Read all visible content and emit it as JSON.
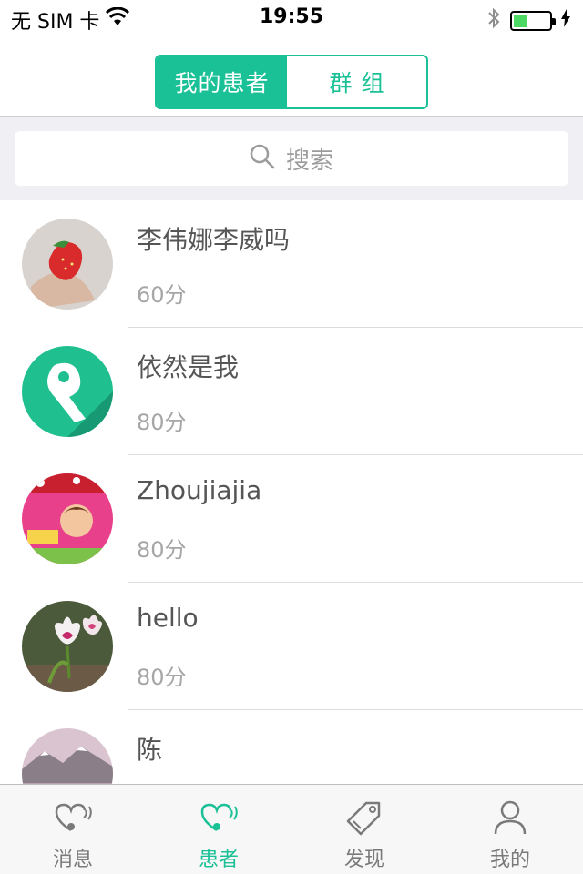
{
  "status_bar": {
    "carrier": "无 SIM 卡",
    "time": "19:55",
    "battery_level": 0.4
  },
  "nav": {
    "segments": [
      {
        "label": "我的患者",
        "active": true
      },
      {
        "label": "群组",
        "active": false
      }
    ],
    "accent_color": "#1ac096"
  },
  "search": {
    "placeholder": "搜索"
  },
  "patients": [
    {
      "name": "李伟娜李威吗",
      "score": "60分",
      "avatar": "strawberry-photo"
    },
    {
      "name": "依然是我",
      "score": "80分",
      "avatar": "green-logo"
    },
    {
      "name": "Zhoujiajia",
      "score": "80分",
      "avatar": "cartoon-photo"
    },
    {
      "name": "hello",
      "score": "80分",
      "avatar": "tulip-photo"
    },
    {
      "name": "陈",
      "score": "",
      "avatar": "mountain-photo"
    }
  ],
  "tabs": [
    {
      "label": "消息",
      "icon": "chat-heart-icon",
      "active": false
    },
    {
      "label": "患者",
      "icon": "patient-heart-icon",
      "active": true
    },
    {
      "label": "发现",
      "icon": "tag-icon",
      "active": false
    },
    {
      "label": "我的",
      "icon": "person-icon",
      "active": false
    }
  ]
}
